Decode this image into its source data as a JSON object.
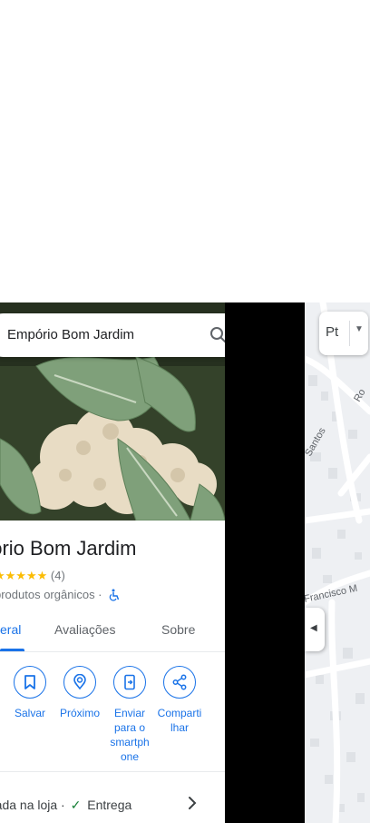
{
  "search": {
    "query": "Empório Bom Jardim"
  },
  "place": {
    "title": "pório Bom Jardim",
    "stars": "★★★★★",
    "review_count": "(4)",
    "category": "produtos orgânicos ·",
    "accessibility_icon": "wheelchair-icon"
  },
  "tabs": [
    {
      "label": "eral",
      "active": true
    },
    {
      "label": "Avaliações",
      "active": false
    },
    {
      "label": "Sobre",
      "active": false
    }
  ],
  "actions": [
    {
      "label": "Salvar",
      "icon": "bookmark-icon"
    },
    {
      "label": "Próximo",
      "icon": "nearby-icon"
    },
    {
      "label": "Enviar para o smartphone",
      "icon": "send-to-phone-icon",
      "lines": [
        "Enviar",
        "para o",
        "smartph",
        "one"
      ]
    },
    {
      "label": "Compartilhar",
      "icon": "share-icon",
      "lines": [
        "Comparti",
        "lhar"
      ]
    }
  ],
  "service": {
    "text_a": "rada na loja ·",
    "text_b": "Entrega"
  },
  "map": {
    "layer_label": "Pt",
    "street_1": "Santos",
    "street_2": "Francisco M",
    "street_3": "Ro"
  },
  "colors": {
    "accent": "#1a73e8",
    "star": "#fbbc04",
    "check": "#188038"
  }
}
